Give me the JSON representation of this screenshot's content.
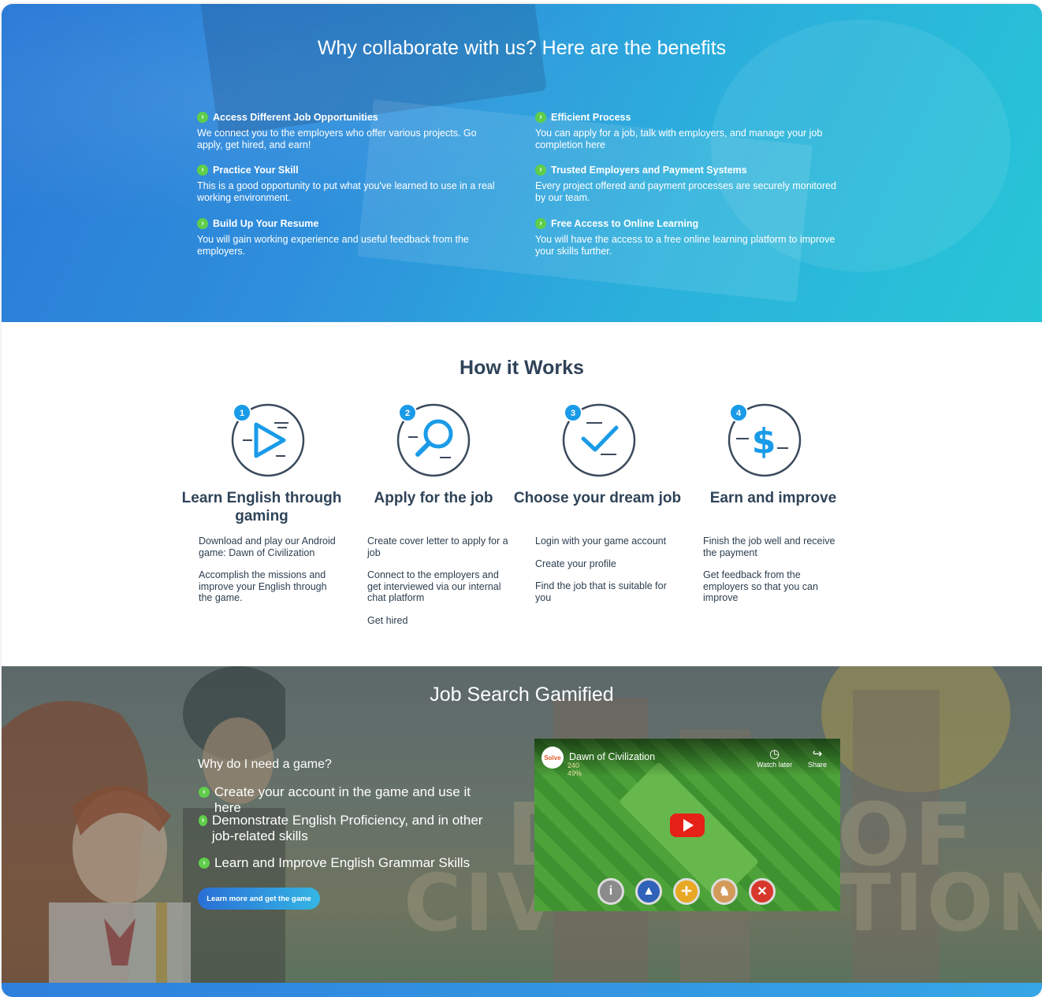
{
  "benefits": {
    "title": "Why collaborate with us? Here are the benefits",
    "items": [
      {
        "title": "Access Different Job Opportunities",
        "desc": "We connect you to the employers who offer various projects.  Go apply, get hired, and earn!"
      },
      {
        "title": "Practice Your Skill",
        "desc": "This is a good opportunity to put what you've learned to use in a real working environment."
      },
      {
        "title": "Build Up Your Resume",
        "desc": "You will gain working experience and useful feedback from the employers."
      },
      {
        "title": "Efficient Process",
        "desc": "You can apply for a job, talk with employers,  and manage your job completion here"
      },
      {
        "title": "Trusted Employers and Payment Systems",
        "desc": "Every project offered and payment processes are securely monitored by our team."
      },
      {
        "title": "Free Access to Online Learning",
        "desc": "You will have the access to a free online learning platform to improve your skills further."
      }
    ]
  },
  "how": {
    "title": "How it Works",
    "steps": [
      {
        "number": "1",
        "icon": "play-icon",
        "title": "Learn English through gaming",
        "paragraphs": [
          "Download and play our Android game: Dawn of Civilization",
          "Accomplish the missions and improve your English through the game."
        ]
      },
      {
        "number": "2",
        "icon": "search-icon",
        "title": "Apply for the job",
        "paragraphs": [
          "Create cover letter to apply for a job",
          "Connect to the employers and get interviewed via our internal chat platform",
          "Get hired"
        ]
      },
      {
        "number": "3",
        "icon": "checkmark-icon",
        "title": "Choose your dream job",
        "paragraphs": [
          "Login with your game account",
          "Create your profile",
          "Find the job that is suitable for you"
        ]
      },
      {
        "number": "4",
        "icon": "dollar-icon",
        "title": "Earn and improve",
        "paragraphs": [
          "Finish the job well and receive the payment",
          "Get feedback from the employers so that you can improve"
        ]
      }
    ],
    "accent_color": "#1a9be8",
    "ring_color": "#3b4a5c"
  },
  "game": {
    "title": "Job Search Gamified",
    "question": "Why do I need a game?",
    "items": [
      "Create your account in the game and use it here",
      "Demonstrate English Proficiency, and in other job-related skills",
      "Learn and Improve English Grammar Skills"
    ],
    "button_label": "Learn more and get the game",
    "video": {
      "title": "Dawn of Civilization",
      "channel_logo": "Solve",
      "stat_1": "240",
      "stat_2": "49%",
      "watch_later": "Watch later",
      "share": "Share"
    },
    "background_words": [
      "D",
      "OF",
      "CIV",
      "TION"
    ]
  }
}
